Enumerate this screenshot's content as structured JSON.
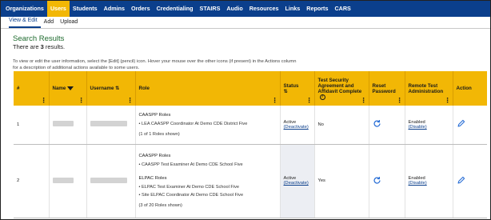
{
  "nav": {
    "items": [
      "Organizations",
      "Users",
      "Students",
      "Admins",
      "Orders",
      "Credentialing",
      "STAIRS",
      "Audio",
      "Resources",
      "Links",
      "Reports",
      "CARS"
    ],
    "active_index": 1
  },
  "subnav": {
    "items": [
      "View & Edit",
      "Add",
      "Upload"
    ],
    "active_index": 0
  },
  "search": {
    "title": "Search Results",
    "count_prefix": "There are ",
    "count": "3",
    "count_suffix": " results.",
    "instructions": "To view or edit the user information, select the [Edit] (pencil) icon. Hover your mouse over the other icons (if present) in the Actions column for a description of additional actions available to some users."
  },
  "table": {
    "headers": {
      "num": "#",
      "name": "Name",
      "username": "Username",
      "role": "Role",
      "status": "Status",
      "tsa": "Test Security Agreement and Affidavit Complete",
      "reset": "Reset Password",
      "remote": "Remote Test Administration",
      "action": "Action"
    },
    "rows": [
      {
        "num": "1",
        "role_groups": [
          {
            "title": "CAASPP Roles",
            "roles": [
              "LEA CAASPP Coordinator At Demo CDE District Five"
            ]
          }
        ],
        "roles_shown": "(1 of 1 Roles shown)",
        "status": "Active",
        "status_action": "(Deactivate)",
        "tsa": "No",
        "remote": "Enabled",
        "remote_action": "(Disable)"
      },
      {
        "num": "2",
        "role_groups": [
          {
            "title": "CAASPP Roles",
            "roles": [
              "CAASPP Test Examiner At Demo CDE School Five"
            ]
          },
          {
            "title": "ELPAC Roles",
            "roles": [
              "ELPAC Test Examiner At Demo CDE School Five",
              "Site ELPAC Coordinator At Demo CDE School Five"
            ]
          }
        ],
        "roles_shown": "(3 of 20 Roles shown)",
        "status": "Active",
        "status_action": "(Deactivate)",
        "tsa": "Yes",
        "remote": "Enabled",
        "remote_action": "(Disable)"
      }
    ]
  },
  "colors": {
    "nav_bg": "#0b3f8c",
    "accent": "#f2b705",
    "title_green": "#1f6b2f",
    "link": "#0b3f8c"
  },
  "icons": {
    "reset": "refresh-icon",
    "edit": "pencil-icon",
    "sort_desc": "sort-down-icon",
    "sort_both": "sort-updown-icon",
    "help": "help-circle-icon"
  }
}
